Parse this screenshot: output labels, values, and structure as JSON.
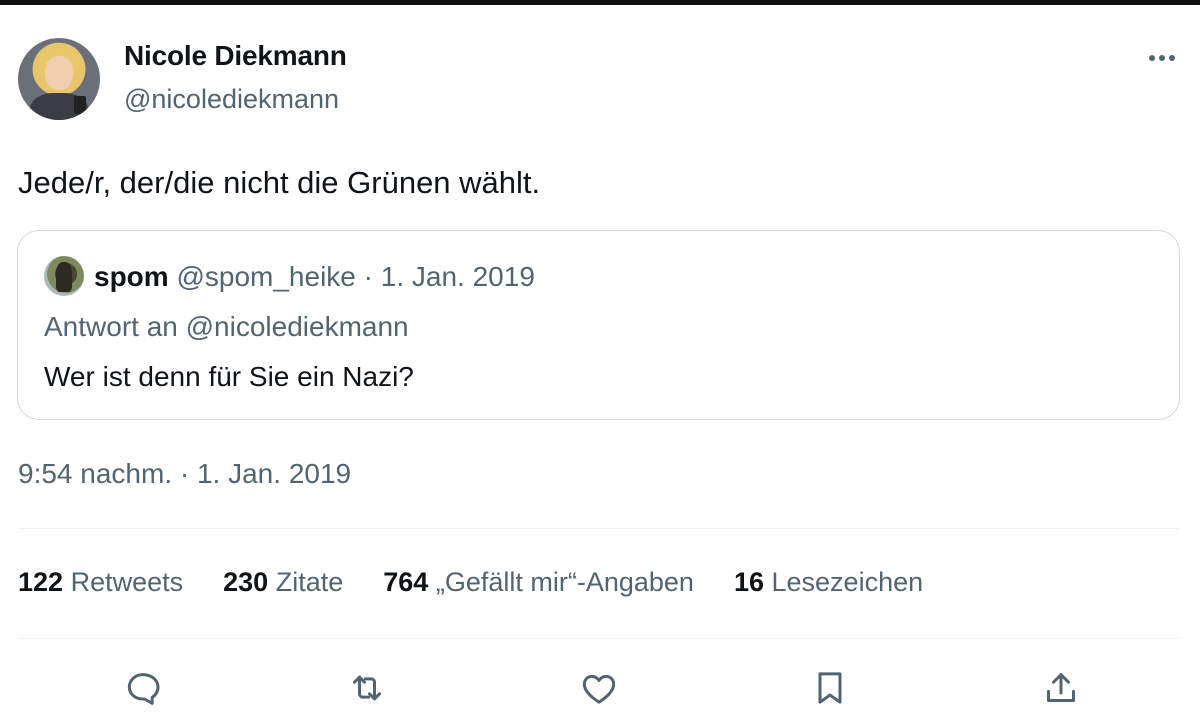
{
  "author": {
    "name": "Nicole Diekmann",
    "handle": "@nicolediekmann"
  },
  "tweet": {
    "text": "Jede/r, der/die nicht die Grünen wählt.",
    "timestamp": "9:54 nachm. · 1. Jan. 2019"
  },
  "quote": {
    "name": "spom",
    "handle": "@spom_heike",
    "separator": "·",
    "date": "1. Jan. 2019",
    "reply_to": "Antwort an @nicolediekmann",
    "text": "Wer ist denn für Sie ein Nazi?"
  },
  "stats": {
    "retweets": {
      "count": "122",
      "label": "Retweets"
    },
    "quotes": {
      "count": "230",
      "label": "Zitate"
    },
    "likes": {
      "count": "764",
      "label": "„Gefällt mir“-Angaben"
    },
    "bookmarks": {
      "count": "16",
      "label": "Lesezeichen"
    }
  },
  "actions": {
    "reply_icon": "reply-icon",
    "retweet_icon": "retweet-icon",
    "like_icon": "heart-icon",
    "bookmark_icon": "bookmark-icon",
    "share_icon": "share-icon"
  },
  "colors": {
    "text_primary": "#0f1419",
    "text_secondary": "#536471",
    "border": "#cfd9de"
  }
}
